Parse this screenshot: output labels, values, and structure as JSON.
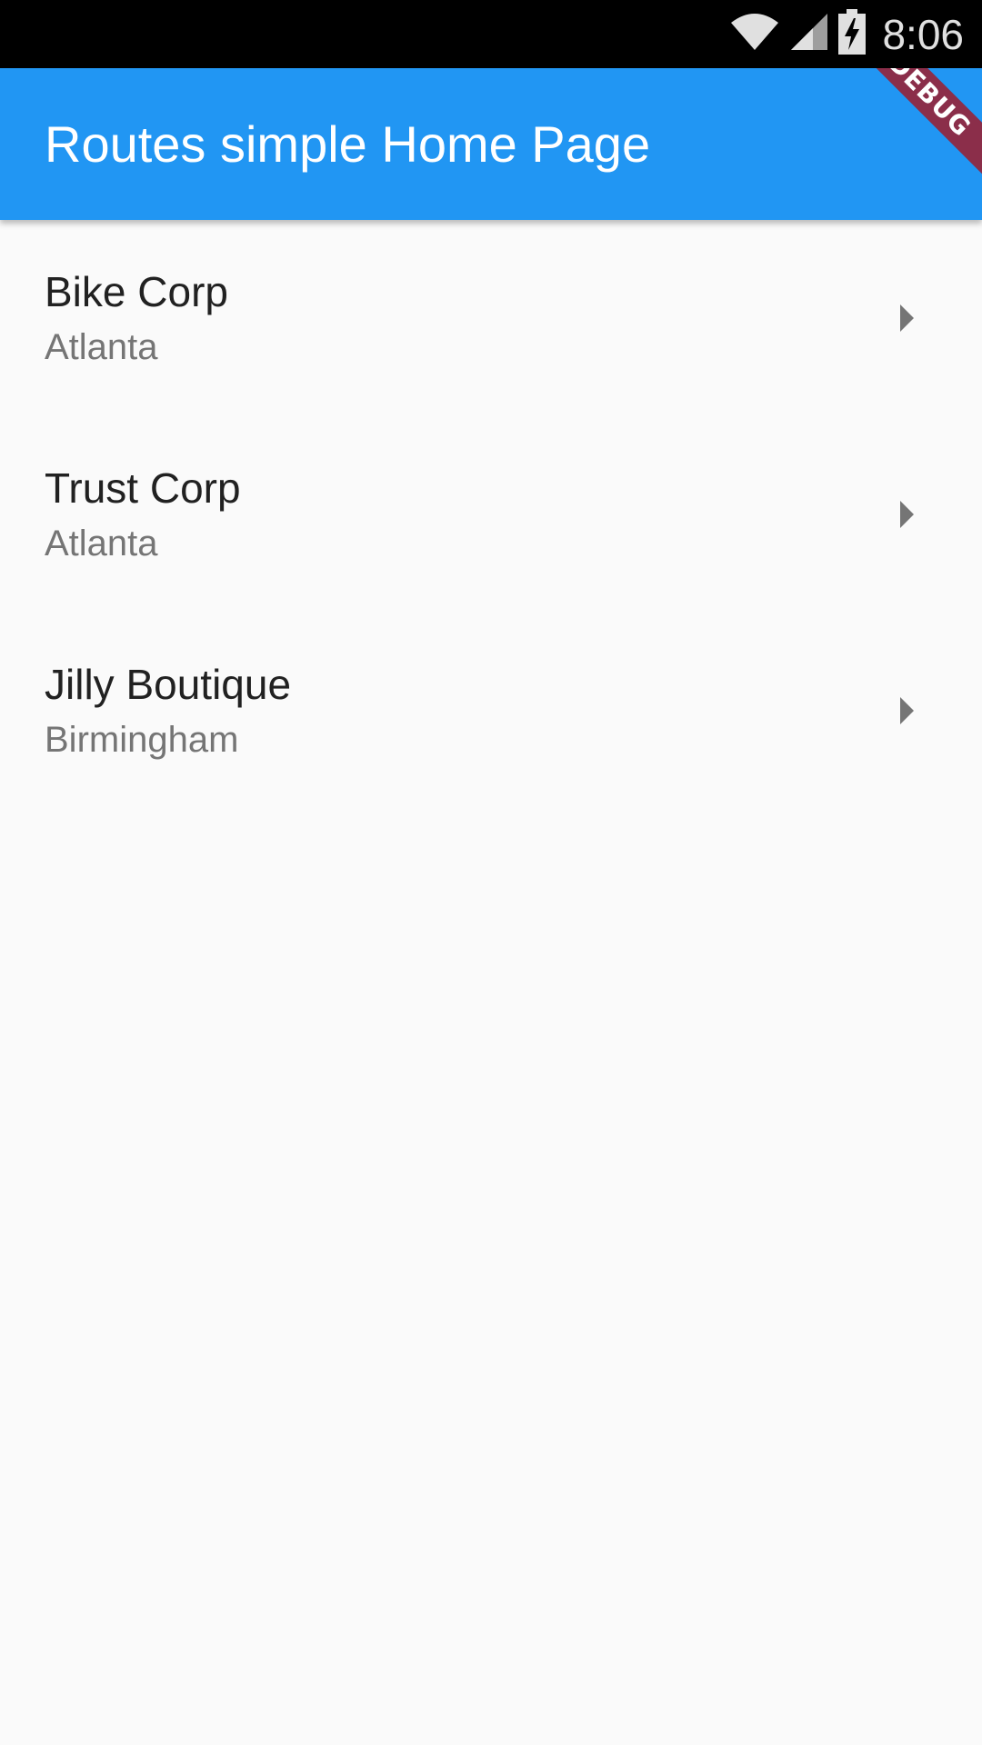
{
  "status_bar": {
    "time": "8:06",
    "icons": [
      "wifi-icon",
      "signal-icon",
      "battery-charging-icon"
    ]
  },
  "app_bar": {
    "title": "Routes simple Home Page",
    "color": "#2196f3",
    "debug_banner": "DEBUG"
  },
  "list": {
    "items": [
      {
        "title": "Bike Corp",
        "subtitle": "Atlanta",
        "trailing_icon": "arrow-right-icon"
      },
      {
        "title": "Trust Corp",
        "subtitle": "Atlanta",
        "trailing_icon": "arrow-right-icon"
      },
      {
        "title": "Jilly Boutique",
        "subtitle": "Birmingham",
        "trailing_icon": "arrow-right-icon"
      }
    ]
  }
}
